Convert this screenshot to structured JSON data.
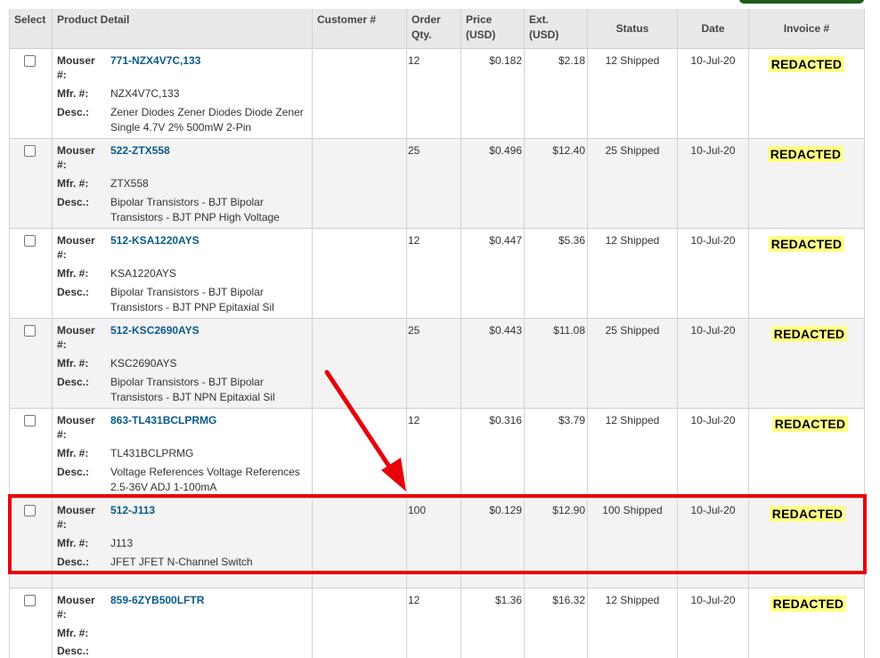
{
  "headers": {
    "select": "Select",
    "product_detail": "Product Detail",
    "customer": "Customer #",
    "order_qty": "Order\nQty.",
    "price": "Price\n(USD)",
    "ext": "Ext.\n(USD)",
    "status": "Status",
    "date": "Date",
    "invoice": "Invoice #"
  },
  "labels": {
    "mouser": "Mouser\n#:",
    "mfr": "Mfr. #:",
    "desc": "Desc.:"
  },
  "rows": [
    {
      "mouser": "771-NZX4V7C,133",
      "mfr": "NZX4V7C,133",
      "desc": "Zener Diodes Zener Diodes Diode Zener Single 4.7V 2% 500mW 2-Pin",
      "qty": "12",
      "price": "$0.182",
      "ext": "$2.18",
      "status": "12 Shipped",
      "date": "10-Jul-20",
      "invoice": "REDACTED"
    },
    {
      "mouser": "522-ZTX558",
      "mfr": "ZTX558",
      "desc": "Bipolar Transistors - BJT Bipolar Transistors - BJT PNP High Voltage",
      "qty": "25",
      "price": "$0.496",
      "ext": "$12.40",
      "status": "25 Shipped",
      "date": "10-Jul-20",
      "invoice": "REDACTED"
    },
    {
      "mouser": "512-KSA1220AYS",
      "mfr": "KSA1220AYS",
      "desc": "Bipolar Transistors - BJT Bipolar Transistors - BJT PNP Epitaxial Sil",
      "qty": "12",
      "price": "$0.447",
      "ext": "$5.36",
      "status": "12 Shipped",
      "date": "10-Jul-20",
      "invoice": "REDACTED"
    },
    {
      "mouser": "512-KSC2690AYS",
      "mfr": "KSC2690AYS",
      "desc": "Bipolar Transistors - BJT Bipolar Transistors - BJT NPN Epitaxial Sil",
      "qty": "25",
      "price": "$0.443",
      "ext": "$11.08",
      "status": "25 Shipped",
      "date": "10-Jul-20",
      "invoice": "REDACTED"
    },
    {
      "mouser": "863-TL431BCLPRMG",
      "mfr": "TL431BCLPRMG",
      "desc": "Voltage References Voltage References 2.5-36V ADJ 1-100mA",
      "qty": "12",
      "price": "$0.316",
      "ext": "$3.79",
      "status": "12 Shipped",
      "date": "10-Jul-20",
      "invoice": "REDACTED"
    },
    {
      "mouser": "512-J113",
      "mfr": "J113",
      "desc": "JFET JFET N-Channel Switch",
      "qty": "100",
      "price": "$0.129",
      "ext": "$12.90",
      "status": "100 Shipped",
      "date": "10-Jul-20",
      "invoice": "REDACTED"
    },
    {
      "mouser": "859-6ZYB500LFTR",
      "mfr": "",
      "desc": "",
      "qty": "12",
      "price": "$1.36",
      "ext": "$16.32",
      "status": "12 Shipped",
      "date": "10-Jul-20",
      "invoice": "REDACTED"
    }
  ],
  "colors": {
    "highlight": "#e8000b",
    "link": "#0b5a8a",
    "redaction": "#ffff88"
  }
}
